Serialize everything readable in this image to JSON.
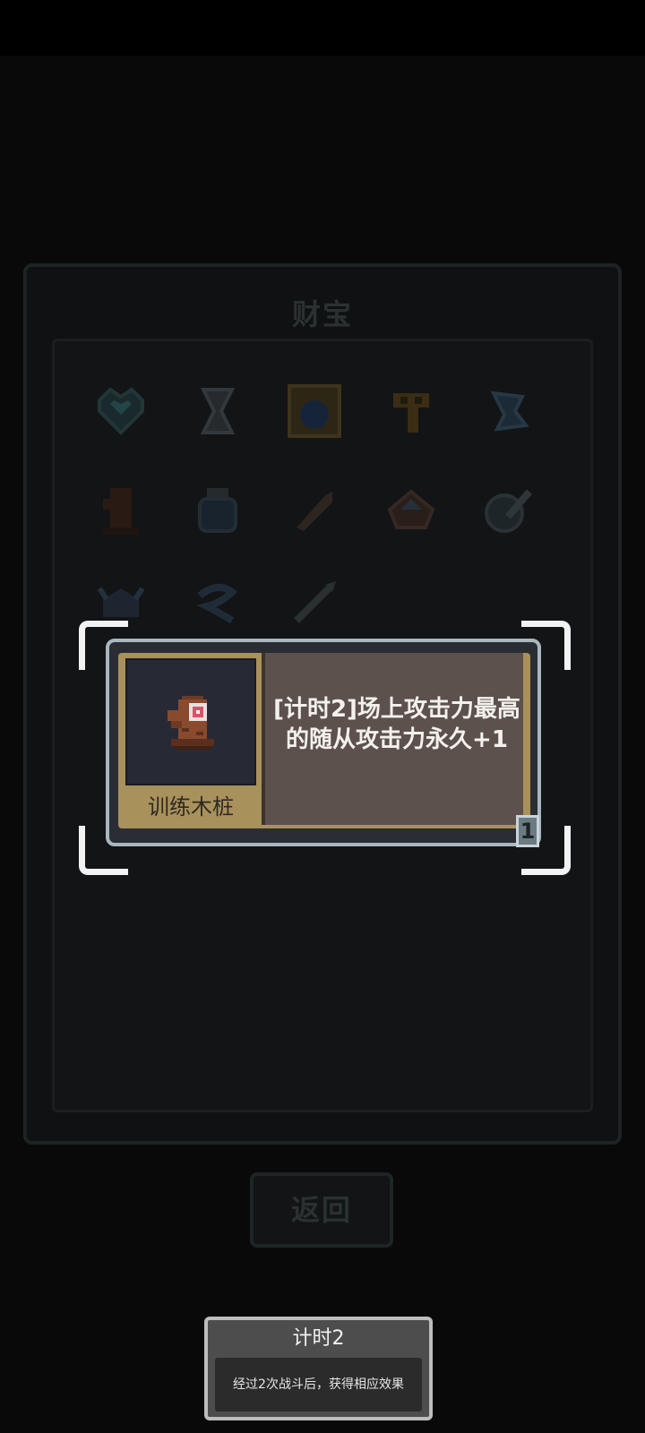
{
  "panel": {
    "title": "财宝"
  },
  "items": [
    {
      "icon": "heart-gem-icon"
    },
    {
      "icon": "hourglass-icon"
    },
    {
      "icon": "blue-orb-frame-icon"
    },
    {
      "icon": "gold-key-icon"
    },
    {
      "icon": "blue-scroll-icon"
    },
    {
      "icon": "wooden-dummy-icon"
    },
    {
      "icon": "potion-jar-icon"
    },
    {
      "icon": "bone-club-icon"
    },
    {
      "icon": "crystal-bowl-icon"
    },
    {
      "icon": "sword-shield-icon"
    },
    {
      "icon": "helmet-icon"
    },
    {
      "icon": "wind-swirl-icon"
    },
    {
      "icon": "dagger-icon"
    }
  ],
  "card": {
    "name": "训练木桩",
    "description": "[计时2]场上攻击力最高的随从攻击力永久+1",
    "level": "1",
    "icon": "training-dummy-icon"
  },
  "back_button": {
    "label": "返回"
  },
  "tooltip": {
    "title": "计时2",
    "body": "经过2次战斗后，获得相应效果"
  }
}
